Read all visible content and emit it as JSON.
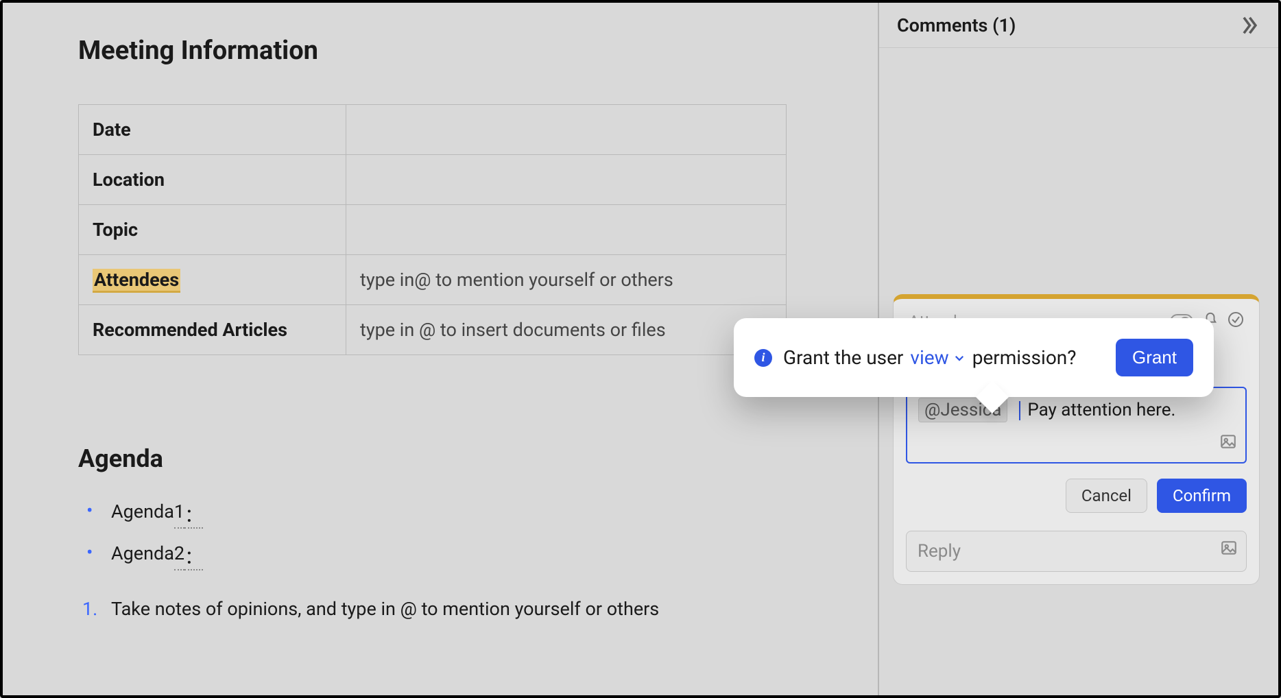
{
  "section_title": "Meeting Information",
  "table": {
    "rows": [
      {
        "label": "Date",
        "value": ""
      },
      {
        "label": "Location",
        "value": ""
      },
      {
        "label": "Topic",
        "value": ""
      },
      {
        "label": "Attendees",
        "value": "type in@ to mention yourself or others",
        "highlight": true,
        "hint": true
      },
      {
        "label": "Recommended Articles",
        "value": "type in @ to insert documents or files",
        "hint": true
      }
    ]
  },
  "agenda_title": "Agenda",
  "agenda_items": [
    "Agenda 1",
    "Agenda 2"
  ],
  "agenda_punct": "：",
  "steps": [
    {
      "num": "1.",
      "text": "Take notes of opinions, and type in @ to mention yourself or others"
    }
  ],
  "comments": {
    "panel_title": "Comments (1)",
    "quoted_text": "Attendees",
    "mention": "@Jessica",
    "body": "Pay attention here.",
    "cancel": "Cancel",
    "confirm": "Confirm",
    "reply_placeholder": "Reply"
  },
  "permission_popover": {
    "text_before": "Grant the user",
    "level": "view",
    "text_after": "permission?",
    "button": "Grant"
  }
}
